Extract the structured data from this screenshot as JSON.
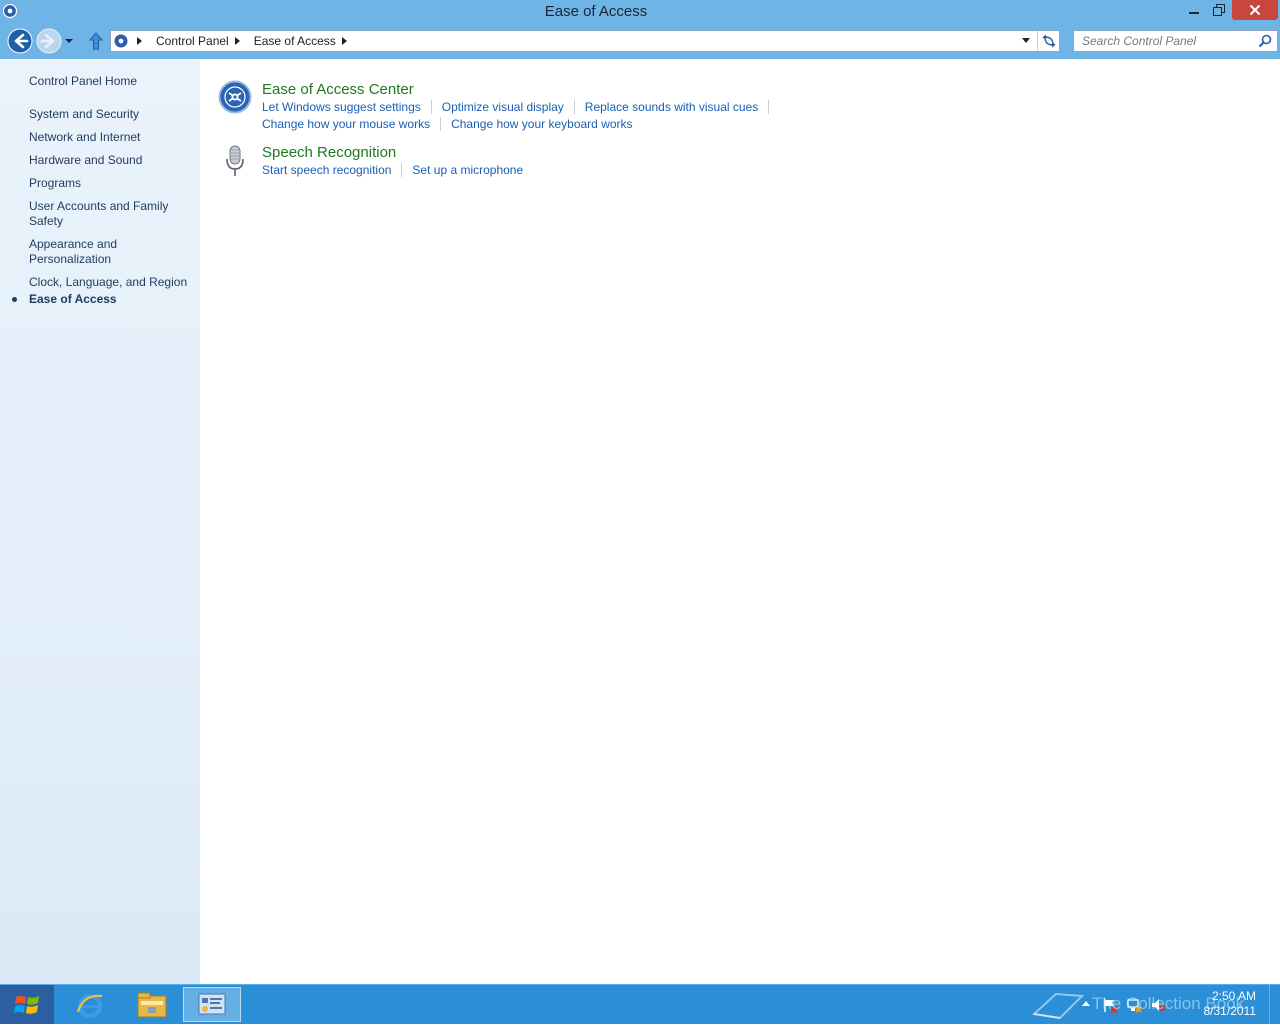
{
  "window": {
    "title": "Ease of Access"
  },
  "address_bar": {
    "crumbs": [
      "Control Panel",
      "Ease of Access"
    ]
  },
  "search": {
    "placeholder": "Search Control Panel"
  },
  "sidebar": {
    "home": "Control Panel Home",
    "items": [
      "System and Security",
      "Network and Internet",
      "Hardware and Sound",
      "Programs",
      "User Accounts and Family Safety",
      "Appearance and Personalization",
      "Clock, Language, and Region"
    ],
    "current": "Ease of Access"
  },
  "main": {
    "categories": [
      {
        "title": "Ease of Access Center",
        "icon": "ease-of-access-icon",
        "links_row1": [
          "Let Windows suggest settings",
          "Optimize visual display",
          "Replace sounds with visual cues"
        ],
        "links_row2": [
          "Change how your mouse works",
          "Change how your keyboard works"
        ]
      },
      {
        "title": "Speech Recognition",
        "icon": "microphone-icon",
        "links_row1": [
          "Start speech recognition",
          "Set up a microphone"
        ]
      }
    ]
  },
  "taskbar": {
    "clock_time": "2:50 AM",
    "clock_date": "8/31/2011",
    "watermark": "The Collection Book"
  },
  "colors": {
    "chrome": "#6fb4e6",
    "sidebar": "#e3eef9",
    "category_title": "#1f7a1f",
    "link": "#1a5fb4",
    "taskbar": "#2a8fd6"
  }
}
